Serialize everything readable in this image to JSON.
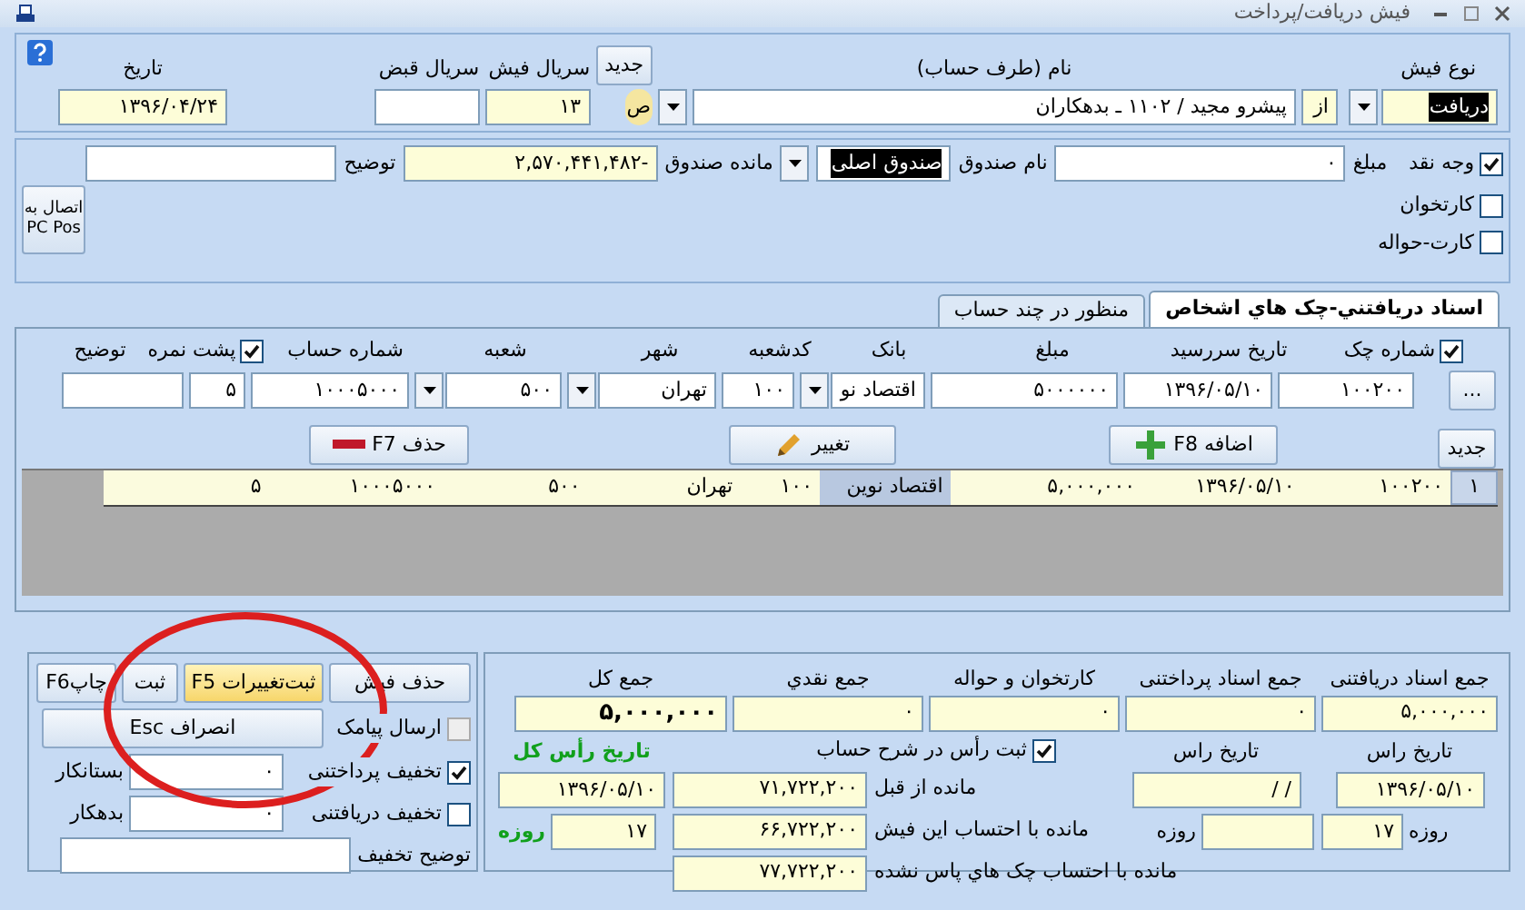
{
  "window": {
    "title": "فیش دریافت/پرداخت"
  },
  "header": {
    "type_label": "نوع فیش",
    "type_value": "دریافت",
    "from": "از",
    "name_label": "نام (طرف حساب)",
    "name_value": "پیشرو مجید / ۱۱۰۲ ـ بدهکاران",
    "marker": "ص",
    "new_button": "جدید",
    "serial_label": "سریال فیش",
    "serial_value": "۱۳",
    "receipt_serial_label": "سریال قبض",
    "date_label": "تاریخ",
    "date_value": "۱۳۹۶/۰۴/۲۴"
  },
  "payment": {
    "methods": [
      {
        "label": "وجه نقد",
        "checked": true
      },
      {
        "label": "کارتخوان",
        "checked": false
      },
      {
        "label": "کارت-حواله",
        "checked": false
      }
    ],
    "amount_label": "مبلغ",
    "amount_value": "۰",
    "fund_label": "نام صندوق",
    "fund_value": "صندوق اصلی",
    "balance_label": "مانده صندوق",
    "balance_value": "-۲,۵۷۰,۴۴۱,۴۸۲",
    "note_label": "توضیح",
    "pos_button": "اتصال به PC Pos"
  },
  "tabs": [
    {
      "label": "اسناد دریافتني-چک هاي اشخاص",
      "selected": true
    },
    {
      "label": "منظور در چند حساب",
      "selected": false
    }
  ],
  "cheque": {
    "columns": [
      {
        "label": "شماره چک",
        "checked": true
      },
      {
        "label": "تاریخ سررسید"
      },
      {
        "label": "مبلغ"
      },
      {
        "label": "بانک"
      },
      {
        "label": "کدشعبه"
      },
      {
        "label": "شهر"
      },
      {
        "label": "شعبه"
      },
      {
        "label": "شماره حساب"
      },
      {
        "label": "پشت نمره",
        "checked": true
      },
      {
        "label": "توضیح"
      }
    ],
    "more_button": "...",
    "inputs": [
      {
        "kind": "text",
        "value": "۱۰۰۲۰۰"
      },
      {
        "kind": "text",
        "value": "۱۳۹۶/۰۵/۱۰"
      },
      {
        "kind": "text",
        "value": "۵۰۰۰۰۰۰"
      },
      {
        "kind": "combo",
        "value": "اقتصاد نو"
      },
      {
        "kind": "text",
        "value": "۱۰۰"
      },
      {
        "kind": "combo",
        "value": "تهران"
      },
      {
        "kind": "combo",
        "value": "۵۰۰"
      },
      {
        "kind": "text",
        "value": "۱۰۰۰۵۰۰۰"
      },
      {
        "kind": "text",
        "value": "۵"
      },
      {
        "kind": "text"
      }
    ],
    "buttons": [
      {
        "kind": "new",
        "label": "جدید"
      },
      {
        "kind": "add",
        "label": "اضافه F8"
      },
      {
        "kind": "edit",
        "label": "تغییر"
      },
      {
        "kind": "delete",
        "label": "حذف F7"
      }
    ],
    "rows": [
      {
        "number": "۱",
        "cells": [
          {
            "text": "۱۰۰۲۰۰",
            "selected": false
          },
          {
            "text": "۱۳۹۶/۰۵/۱۰",
            "selected": false
          },
          {
            "text": "۵,۰۰۰,۰۰۰",
            "selected": false
          },
          {
            "text": "اقتصاد نوین",
            "selected": true
          },
          {
            "text": "۱۰۰",
            "selected": false
          },
          {
            "text": "تهران",
            "selected": false
          },
          {
            "text": "۵۰۰",
            "selected": false
          },
          {
            "text": "۱۰۰۰۵۰۰۰",
            "selected": false
          },
          {
            "text": "۵",
            "selected": false
          },
          {
            "text": "",
            "selected": false
          }
        ]
      }
    ]
  },
  "actions": {
    "delete": "حذف فیش",
    "save_changes": "ثبت‌تغییرات F5",
    "save": "ثبت",
    "print": "چاپF6",
    "cancel": "انصراف Esc",
    "options": [
      {
        "label": "ارسال پیامک",
        "checked": false,
        "disabled": true
      },
      {
        "label": "تخفیف پرداختنی",
        "checked": true,
        "disabled": false
      },
      {
        "label": "تخفیف دریافتنی",
        "checked": false,
        "disabled": false
      }
    ],
    "creditor_label": "بستانکار",
    "creditor_value": "۰",
    "debtor_label": "بدهکار",
    "debtor_value": "۰",
    "discount_note_label": "توضیح تخفیف"
  },
  "totals": {
    "items": [
      {
        "label": "جمع اسناد دریافتنی",
        "value": "۵,۰۰۰,۰۰۰"
      },
      {
        "label": "جمع اسناد پرداختنی",
        "value": "۰"
      },
      {
        "label": "کارتخوان و حواله",
        "value": "۰"
      },
      {
        "label": "جمع نقدي",
        "value": "۰"
      },
      {
        "label": "جمع کل",
        "value": "۵,۰۰۰,۰۰۰"
      }
    ],
    "due_received": {
      "label": "تاریخ راس",
      "date": "۱۳۹۶/۰۵/۱۰",
      "days_label": "روزه",
      "days": "۱۷"
    },
    "due_paid": {
      "label": "تاریخ راس",
      "date": "/ /",
      "days_label": "روزه"
    },
    "record_due": {
      "label": "ثبت رأس در شرح حساب",
      "checked": true
    },
    "balances": [
      {
        "label": "مانده از قبل",
        "value": "۷۱,۷۲۲,۲۰۰"
      },
      {
        "label": "مانده با احتساب این فیش",
        "value": "۶۶,۷۲۲,۲۰۰"
      },
      {
        "label": "مانده با احتساب چک هاي پاس نشده",
        "value": "۷۷,۷۲۲,۲۰۰"
      }
    ],
    "due_total": {
      "label": "تاریخ رأس کل",
      "date": "۱۳۹۶/۰۵/۱۰",
      "days_label": "روزه",
      "days": "۱۷"
    }
  }
}
